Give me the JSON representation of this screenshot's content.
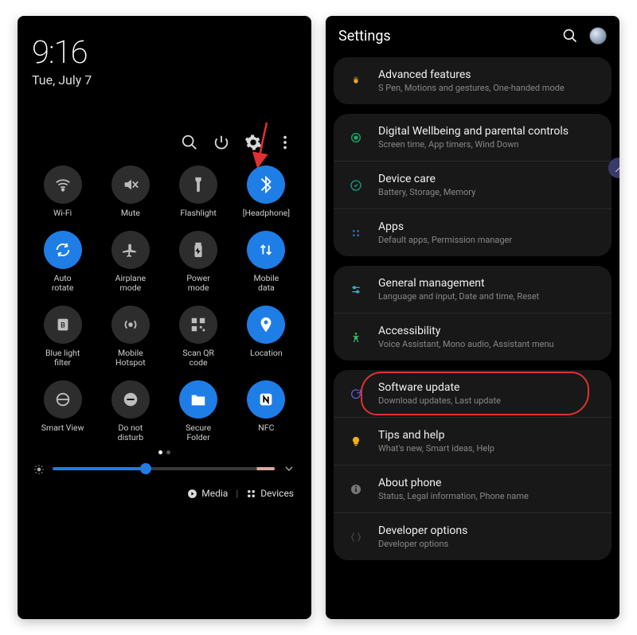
{
  "quick_panel": {
    "clock": "9:16",
    "date": "Tue, July 7",
    "toolbar": {
      "search": "search",
      "power": "power",
      "settings": "settings",
      "more": "more"
    },
    "tiles": [
      {
        "name": "wifi",
        "label": "Wi-Fi",
        "on": false
      },
      {
        "name": "mute",
        "label": "Mute",
        "on": false
      },
      {
        "name": "flashlight",
        "label": "Flashlight",
        "on": false
      },
      {
        "name": "bluetooth",
        "label": "[Headphone]",
        "on": true
      },
      {
        "name": "autorotate",
        "label": "Auto\nrotate",
        "on": true
      },
      {
        "name": "airplane",
        "label": "Airplane\nmode",
        "on": false
      },
      {
        "name": "power-mode",
        "label": "Power\nmode",
        "on": false
      },
      {
        "name": "mobile-data",
        "label": "Mobile\ndata",
        "on": true
      },
      {
        "name": "bluelight",
        "label": "Blue light\nfilter",
        "on": false
      },
      {
        "name": "hotspot",
        "label": "Mobile\nHotspot",
        "on": false
      },
      {
        "name": "qr",
        "label": "Scan QR\ncode",
        "on": false
      },
      {
        "name": "location",
        "label": "Location",
        "on": true
      },
      {
        "name": "smartview",
        "label": "Smart View",
        "on": false
      },
      {
        "name": "dnd",
        "label": "Do not\ndisturb",
        "on": false
      },
      {
        "name": "securefolder",
        "label": "Secure\nFolder",
        "on": true
      },
      {
        "name": "nfc",
        "label": "NFC",
        "on": true
      }
    ],
    "brightness_pct": 42,
    "footer": {
      "media": "Media",
      "devices": "Devices"
    }
  },
  "settings": {
    "title": "Settings",
    "groups": [
      [
        {
          "key": "advanced",
          "icon_color": "#f3a529",
          "title": "Advanced features",
          "sub": "S Pen, Motions and gestures, One-handed mode"
        }
      ],
      [
        {
          "key": "wellbeing",
          "icon_color": "#1aa86a",
          "title": "Digital Wellbeing and parental controls",
          "sub": "Screen time, App timers, Wind Down"
        },
        {
          "key": "devicecare",
          "icon_color": "#159e8c",
          "title": "Device care",
          "sub": "Battery, Storage, Memory"
        },
        {
          "key": "apps",
          "icon_color": "#2b6edd",
          "title": "Apps",
          "sub": "Default apps, Permission manager"
        }
      ],
      [
        {
          "key": "general",
          "icon_color": "#3fa6c1",
          "title": "General management",
          "sub": "Language and input, Date and time, Reset"
        },
        {
          "key": "a11y",
          "icon_color": "#33b36a",
          "title": "Accessibility",
          "sub": "Voice Assistant, Mono audio, Assistant menu"
        }
      ],
      [
        {
          "key": "swupdate",
          "icon_color": "#5b5bd6",
          "title": "Software update",
          "sub": "Download updates, Last update",
          "highlight": true
        },
        {
          "key": "tips",
          "icon_color": "#f0b01a",
          "title": "Tips and help",
          "sub": "What's new, Smart ideas, Help"
        },
        {
          "key": "about",
          "icon_color": "#777",
          "title": "About phone",
          "sub": "Status, Legal information, Phone name"
        },
        {
          "key": "dev",
          "icon_color": "#444",
          "title": "Developer options",
          "sub": "Developer options"
        }
      ]
    ]
  },
  "annotation": {
    "arrow_target": "settings-icon",
    "circle_target": "swupdate"
  }
}
